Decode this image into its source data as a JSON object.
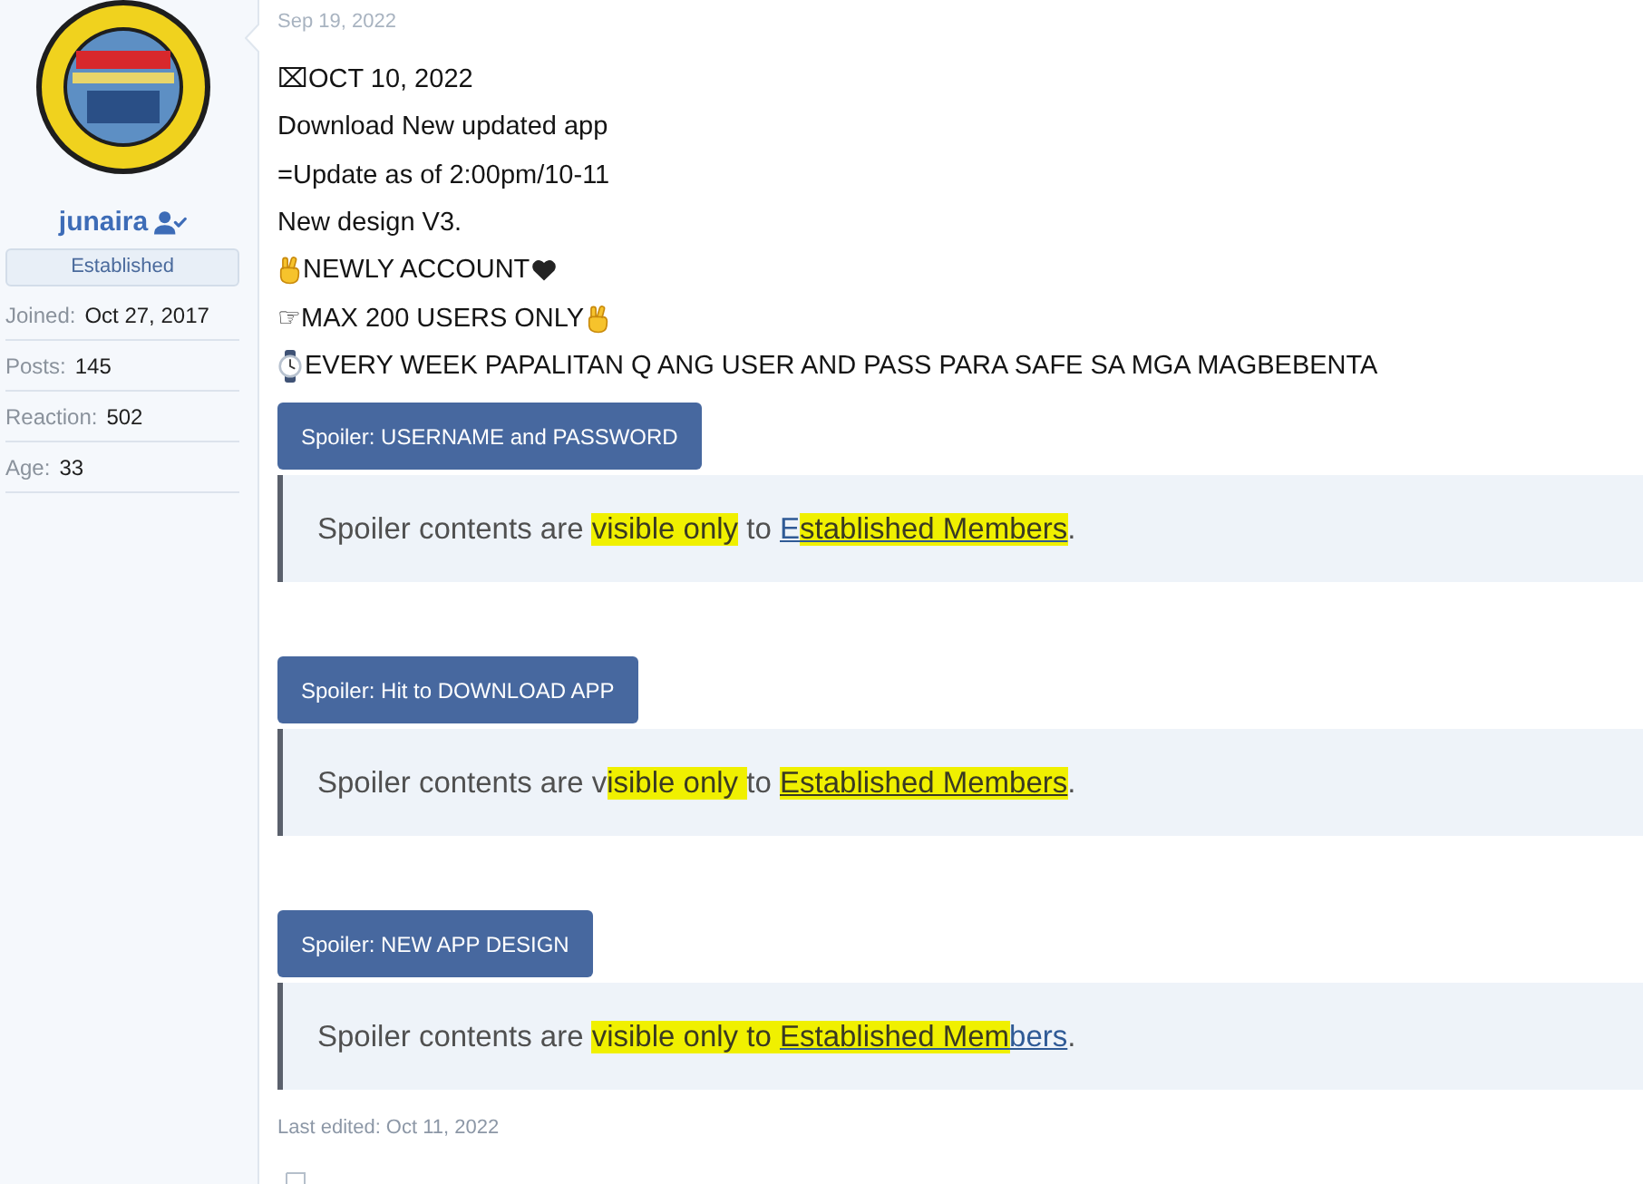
{
  "user": {
    "name": "junaira",
    "badge": "Established",
    "stats": [
      {
        "label": "Joined:",
        "value": "Oct 27, 2017"
      },
      {
        "label": "Posts:",
        "value": "145"
      },
      {
        "label": "Reaction:",
        "value": "502"
      },
      {
        "label": "Age:",
        "value": "33"
      }
    ]
  },
  "post": {
    "date": "Sep 19, 2022",
    "lines": [
      "⌧OCT 10, 2022",
      "Download New updated app",
      "=Update as of 2:00pm/10-11",
      "New design V3.",
      "NEWLY ACCOUNT",
      "☞MAX 200 USERS ONLY",
      "EVERY WEEK PAPALITAN Q ANG USER AND PASS PARA SAFE SA MGA MAGBEBENTA"
    ],
    "spoilers": [
      {
        "button": "Spoiler: USERNAME and PASSWORD",
        "message": [
          {
            "kind": "text",
            "parts": [
              {
                "text": "Spoiler contents are ",
                "highlighted": false
              },
              {
                "text": "visible only",
                "highlighted": true
              },
              {
                "text": " to ",
                "highlighted": false
              }
            ]
          },
          {
            "kind": "link",
            "parts": [
              {
                "text": "E",
                "highlighted": false
              },
              {
                "text": "stablished Members",
                "highlighted": true
              }
            ]
          },
          {
            "kind": "text",
            "parts": [
              {
                "text": ".",
                "highlighted": false
              }
            ]
          }
        ]
      },
      {
        "button": "Spoiler: Hit to DOWNLOAD APP",
        "message": [
          {
            "kind": "text",
            "parts": [
              {
                "text": "Spoiler contents are v",
                "highlighted": false
              },
              {
                "text": "isible only ",
                "highlighted": true
              },
              {
                "text": "to ",
                "highlighted": false
              }
            ]
          },
          {
            "kind": "link",
            "parts": [
              {
                "text": "Established Members",
                "highlighted": true
              }
            ]
          },
          {
            "kind": "text",
            "parts": [
              {
                "text": ".",
                "highlighted": false
              }
            ]
          }
        ]
      },
      {
        "button": "Spoiler: NEW APP DESIGN",
        "message": [
          {
            "kind": "text",
            "parts": [
              {
                "text": "Spoiler contents are ",
                "highlighted": false
              },
              {
                "text": "visible only to ",
                "highlighted": true
              }
            ]
          },
          {
            "kind": "link",
            "parts": [
              {
                "text": "Established Mem",
                "highlighted": true
              },
              {
                "text": "bers",
                "highlighted": false
              }
            ]
          },
          {
            "kind": "text",
            "parts": [
              {
                "text": ".",
                "highlighted": false
              }
            ]
          }
        ]
      }
    ],
    "last_edited": "Last edited: Oct 11, 2022"
  }
}
